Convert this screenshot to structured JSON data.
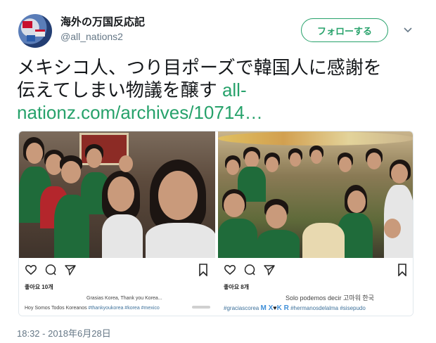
{
  "header": {
    "display_name": "海外の万国反応記",
    "handle": "@all_nations2",
    "follow_label": "フォローする"
  },
  "tweet": {
    "text_line1": "メキシコ人、つり目ポーズで韓国人に感謝を",
    "text_line2_prefix": "伝えてしまい物議を醸す ",
    "link_part1": "all-",
    "link_part2": "nationz.com/archives/10714…"
  },
  "media": {
    "left": {
      "likes": "좋아요 10개",
      "caption_line1": "Grasias Korea, Thank you Korea...",
      "caption_line2_text": "Hoy Somos Todos Koreanos ",
      "caption_line2_tags": "#thankyoukorea #korea #mexico"
    },
    "right": {
      "likes": "좋아요 8개",
      "caption_line1": "Solo podemos decir 고마워 한국",
      "caption_tag1": "#graciascorea",
      "caption_mx": "M X",
      "caption_heart": "♥",
      "caption_kr": "K R",
      "caption_tags2": "#hermanosdelalma #sisepudo"
    }
  },
  "timestamp": "18:32 - 2018年6月28日",
  "colors": {
    "accent": "#27a26b",
    "text": "#14171a",
    "muted": "#657786"
  },
  "icons": {
    "caret": "chevron-down-icon",
    "like": "heart-icon",
    "comment": "comment-icon",
    "share": "send-icon",
    "save": "bookmark-icon"
  }
}
